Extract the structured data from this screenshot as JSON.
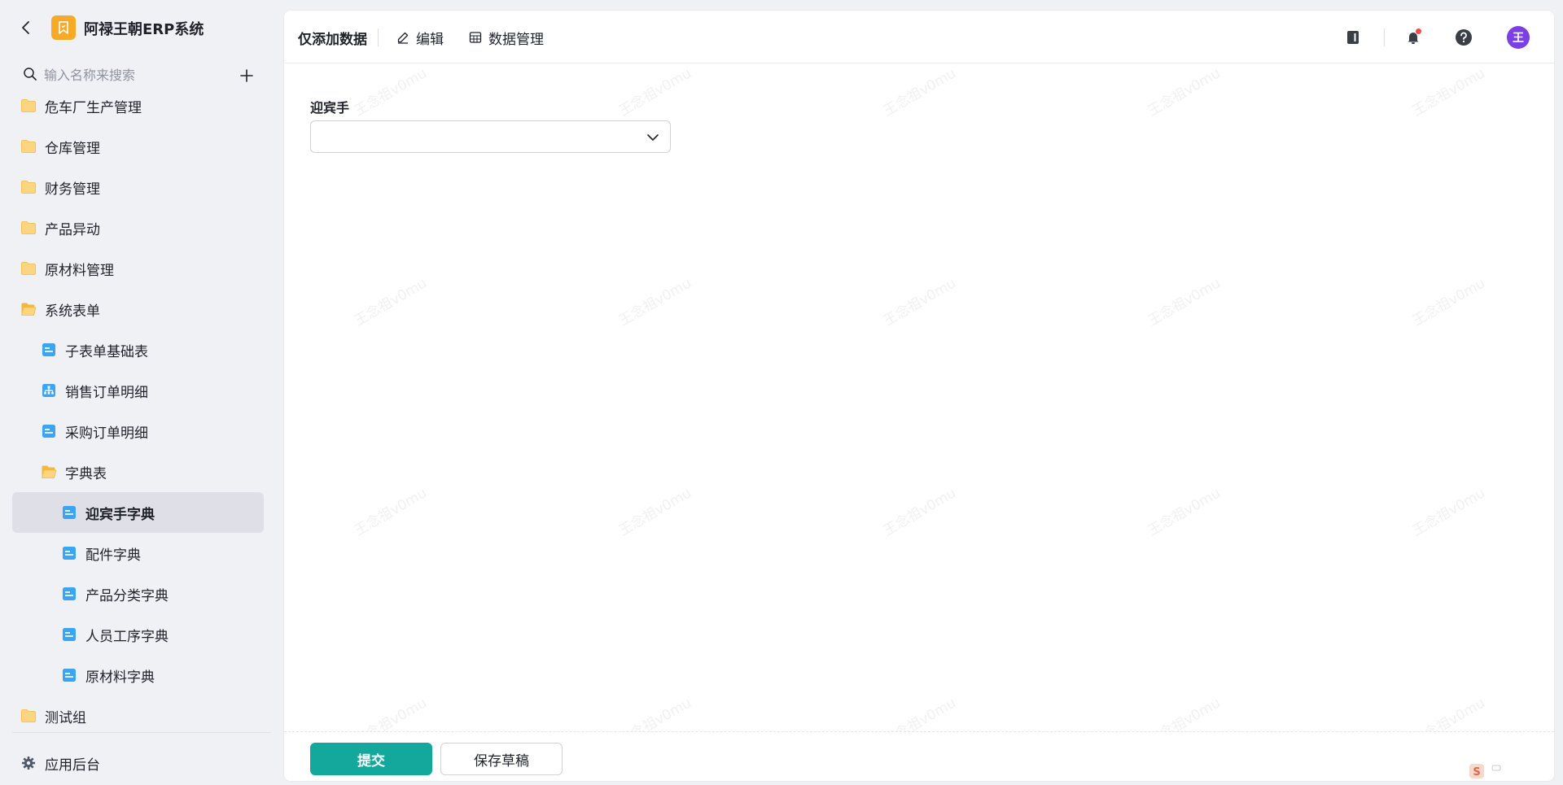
{
  "app": {
    "title": "阿禄王朝ERP系统",
    "brand_color": "#f7a928"
  },
  "search": {
    "placeholder": "输入名称来搜索"
  },
  "sidebar": {
    "items": [
      {
        "label": "危车厂生产管理",
        "level": 0,
        "icon": "folder-icon"
      },
      {
        "label": "仓库管理",
        "level": 0,
        "icon": "folder-icon"
      },
      {
        "label": "财务管理",
        "level": 0,
        "icon": "folder-icon"
      },
      {
        "label": "产品异动",
        "level": 0,
        "icon": "folder-icon"
      },
      {
        "label": "原材料管理",
        "level": 0,
        "icon": "folder-icon"
      },
      {
        "label": "系统表单",
        "level": 0,
        "icon": "folder-open-icon"
      },
      {
        "label": "子表单基础表",
        "level": 1,
        "icon": "form-icon"
      },
      {
        "label": "销售订单明细",
        "level": 1,
        "icon": "report-icon"
      },
      {
        "label": "采购订单明细",
        "level": 1,
        "icon": "form-icon"
      },
      {
        "label": "字典表",
        "level": 1,
        "icon": "folder-open-icon"
      },
      {
        "label": "迎宾手字典",
        "level": 2,
        "icon": "form-icon",
        "active": true
      },
      {
        "label": "配件字典",
        "level": 2,
        "icon": "form-icon"
      },
      {
        "label": "产品分类字典",
        "level": 2,
        "icon": "form-icon"
      },
      {
        "label": "人员工序字典",
        "level": 2,
        "icon": "form-icon"
      },
      {
        "label": "原材料字典",
        "level": 2,
        "icon": "form-icon"
      },
      {
        "label": "测试组",
        "level": 0,
        "icon": "folder-icon"
      }
    ],
    "footer_label": "应用后台"
  },
  "toolbar": {
    "form_title": "仅添加数据",
    "edit_label": "编辑",
    "data_manage_label": "数据管理",
    "avatar_text": "王",
    "avatar_color": "#7b3fe4"
  },
  "form": {
    "field_label": "迎宾手",
    "field_value": ""
  },
  "actions": {
    "submit_label": "提交",
    "draft_label": "保存草稿",
    "submit_color": "#12a89b"
  },
  "watermark": {
    "text": "王念祖v0mu"
  }
}
